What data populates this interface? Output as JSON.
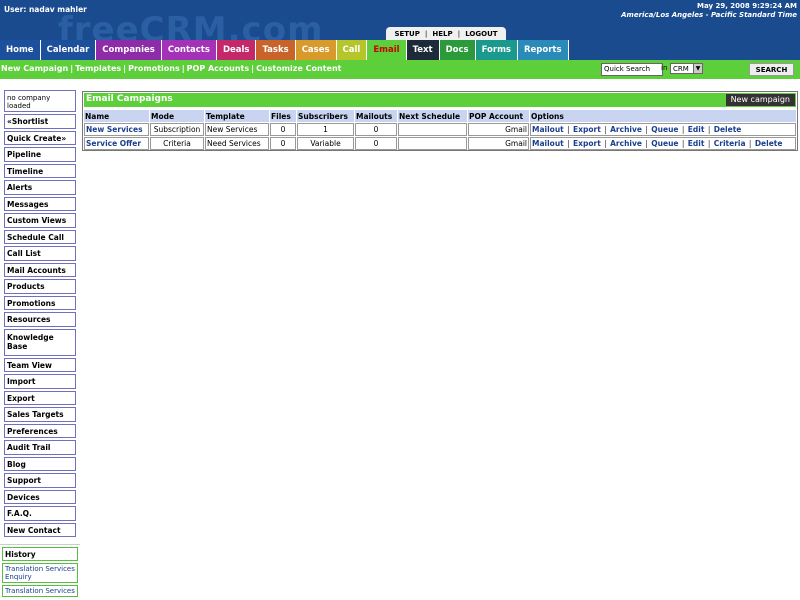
{
  "header": {
    "watermark": "freeCRM.com",
    "user": "User: nadav mahler",
    "datetime": "May 29, 2008 9:29:24 AM",
    "timezone": "America/Los Angeles - Pacific Standard Time",
    "top_links": [
      "SETUP",
      "HELP",
      "LOGOUT"
    ]
  },
  "tabs": [
    {
      "label": "Home",
      "color": "#1c4f9c",
      "text": "#ffffff"
    },
    {
      "label": "Calendar",
      "color": "#1c4f9c",
      "text": "#ffffff"
    },
    {
      "label": "Companies",
      "color": "#8e2ba8",
      "text": "#ffffff"
    },
    {
      "label": "Contacts",
      "color": "#a431b8",
      "text": "#ffffff"
    },
    {
      "label": "Deals",
      "color": "#c4286a",
      "text": "#ffffff"
    },
    {
      "label": "Tasks",
      "color": "#c8642a",
      "text": "#ffffff"
    },
    {
      "label": "Cases",
      "color": "#d89a2a",
      "text": "#ffffff"
    },
    {
      "label": "Call",
      "color": "#b6c62a",
      "text": "#ffffff"
    },
    {
      "label": "Email",
      "color": "#5ccf3a",
      "text": "#cc0000"
    },
    {
      "label": "Text",
      "color": "#1e2a3a",
      "text": "#ffffff"
    },
    {
      "label": "Docs",
      "color": "#2a9a3a",
      "text": "#ffffff"
    },
    {
      "label": "Forms",
      "color": "#1a9a8e",
      "text": "#ffffff"
    },
    {
      "label": "Reports",
      "color": "#2a8ab8",
      "text": "#ffffff"
    }
  ],
  "subnav": [
    "New Campaign",
    "Templates",
    "Promotions",
    "POP Accounts",
    "Customize Content"
  ],
  "search": {
    "value": "Quick Search",
    "in_label": "in",
    "scope": "CRM",
    "button": "SEARCH"
  },
  "sidebar": {
    "no_company": "no company loaded",
    "items": [
      "«Shortlist",
      "Quick Create»",
      "Pipeline",
      "Timeline",
      "Alerts",
      "Messages",
      "Custom Views",
      "Schedule Call",
      "Call List",
      "Mail Accounts",
      "Products",
      "Promotions",
      "Resources",
      "Knowledge Base",
      "Team View",
      "Import",
      "Export",
      "Sales Targets",
      "Preferences",
      "Audit Trail",
      "Blog",
      "Support",
      "Devices",
      "F.A.Q.",
      "New Contact"
    ],
    "history_label": "History",
    "history_items": [
      "Translation Services Enquiry",
      "Translation Services"
    ]
  },
  "campaigns": {
    "title": "Email Campaigns",
    "new_button": "New campaign",
    "columns": [
      "Name",
      "Mode",
      "Template",
      "Files",
      "Subscribers",
      "Mailouts",
      "Next Schedule",
      "POP Account",
      "Options"
    ],
    "rows": [
      {
        "name": "New Services",
        "mode": "Subscription",
        "template": "New Services",
        "files": "0",
        "subscribers": "1",
        "mailouts": "0",
        "next": "",
        "pop": "Gmail",
        "options": [
          "Mailout",
          "Export",
          "Archive",
          "Queue",
          "Edit",
          "Delete"
        ]
      },
      {
        "name": "Service Offer",
        "mode": "Criteria",
        "template": "Need Services",
        "files": "0",
        "subscribers": "Variable",
        "mailouts": "0",
        "next": "",
        "pop": "Gmail",
        "options": [
          "Mailout",
          "Export",
          "Archive",
          "Queue",
          "Edit",
          "Criteria",
          "Delete"
        ]
      }
    ]
  }
}
